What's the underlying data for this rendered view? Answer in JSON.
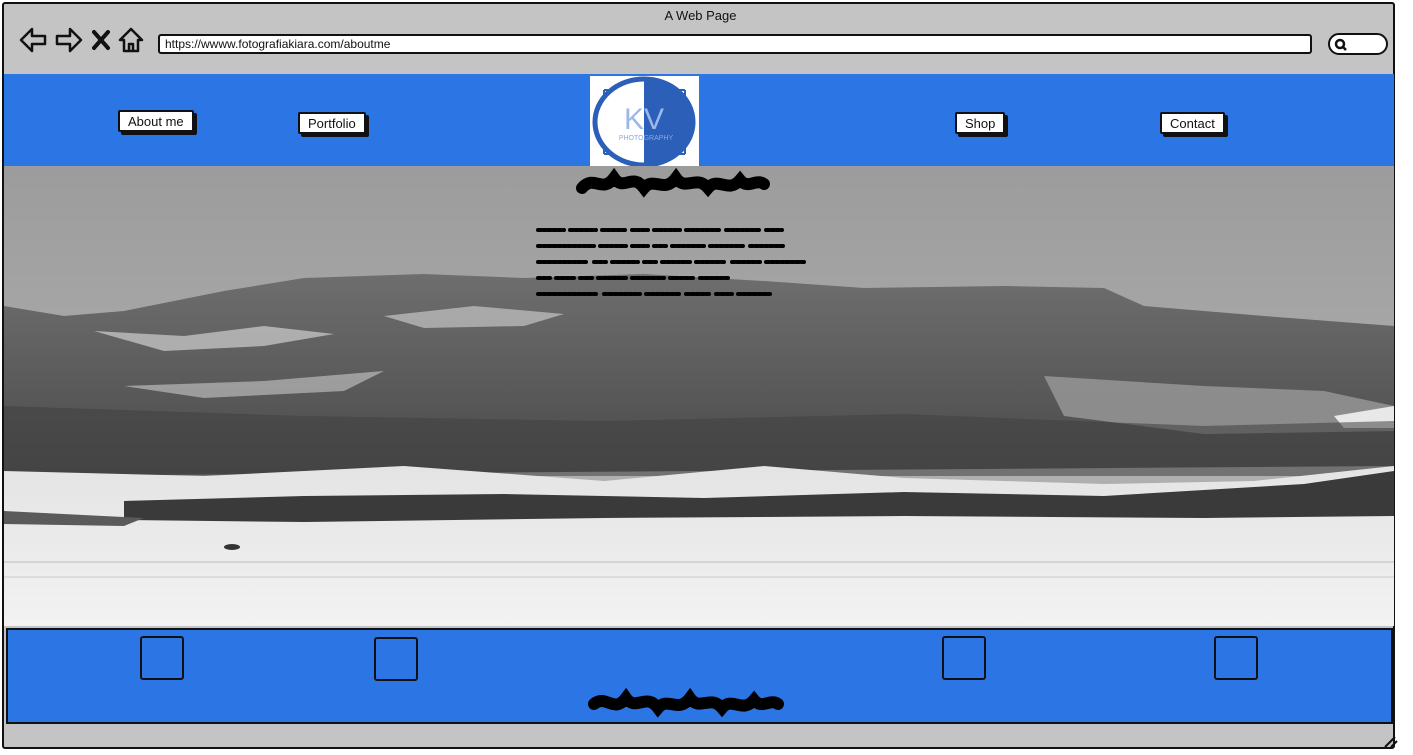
{
  "window": {
    "title": "A Web Page"
  },
  "browser": {
    "url": "https://wwww.fotografiakiara.com/aboutme",
    "icons": [
      "back-icon",
      "forward-icon",
      "close-icon",
      "home-icon",
      "search-icon"
    ]
  },
  "nav": {
    "about_label": "About me",
    "portfolio_label": "Portfolio",
    "shop_label": "Shop",
    "contact_label": "Contact"
  },
  "logo": {
    "initials": "KV",
    "tagline": "PHOTOGRAPHY"
  },
  "colors": {
    "brand_blue": "#2b76e4",
    "chrome_grey": "#c4c4c4",
    "logo_blue": "#2b5fb8"
  },
  "footer": {
    "social_icons": [
      "social-icon-1",
      "social-icon-2",
      "social-icon-3",
      "social-icon-4"
    ]
  }
}
